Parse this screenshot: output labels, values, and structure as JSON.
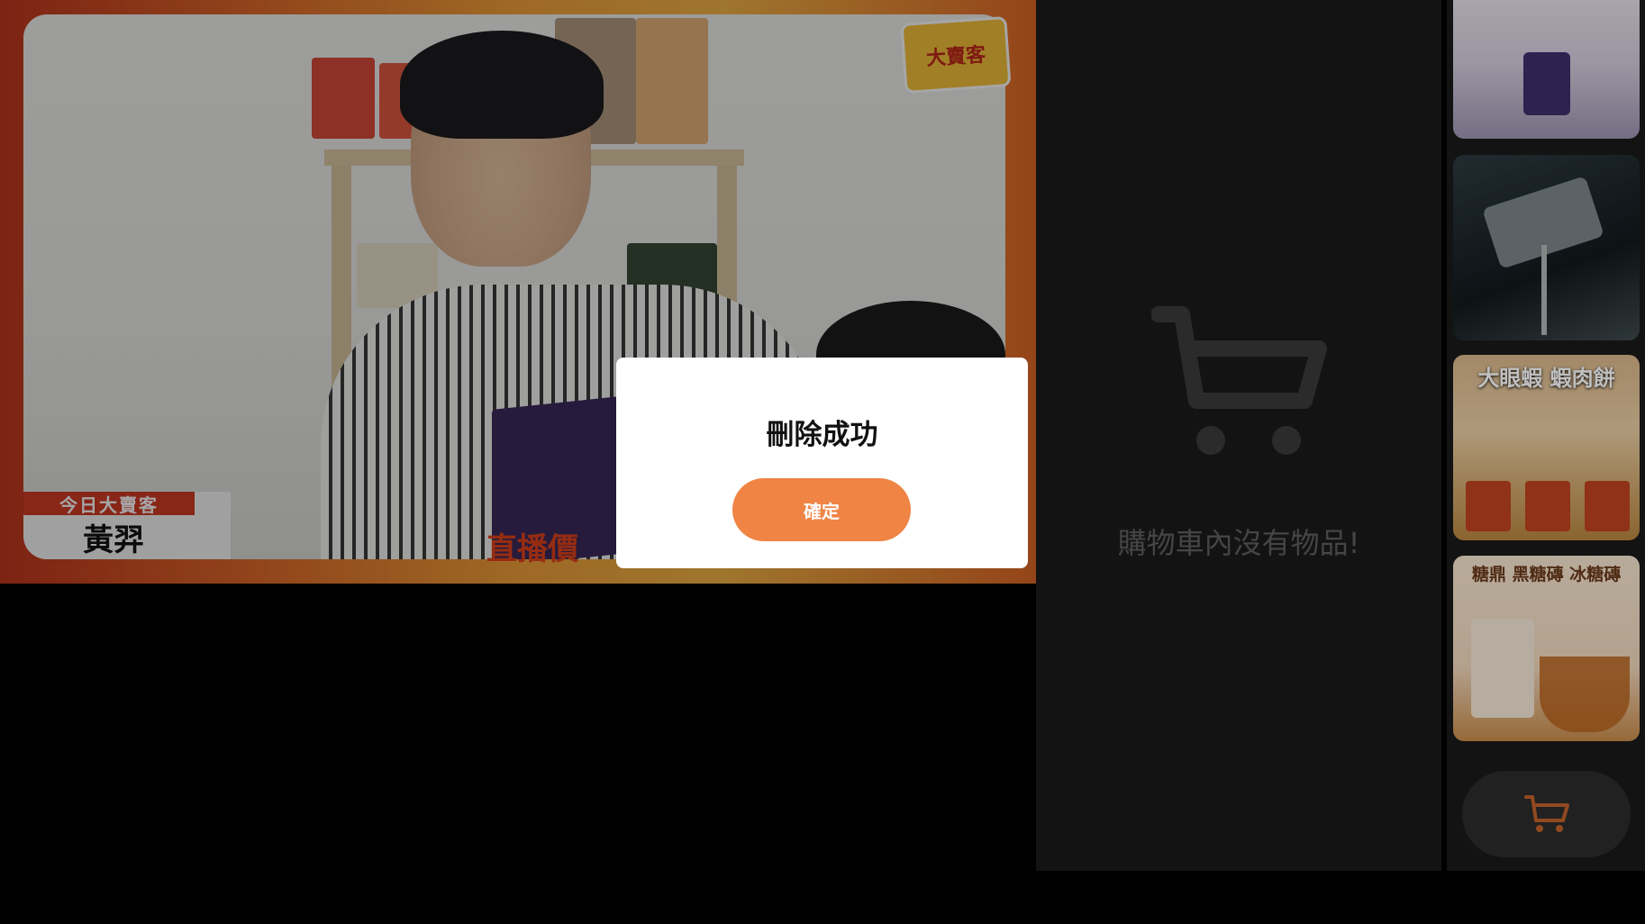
{
  "video": {
    "lower_third_tag": "今日大賣客",
    "host_name": "黃羿",
    "logo_text": "大賣客",
    "price_banner": "直播價"
  },
  "cart": {
    "empty_message": "購物車內沒有物品!"
  },
  "product_strip": {
    "items": [
      {
        "label": ""
      },
      {
        "label": ""
      },
      {
        "label": "大眼蝦 蝦肉餅"
      },
      {
        "label": "糖鼎 黑糖磚 冰糖磚"
      }
    ]
  },
  "dialog": {
    "title": "刪除成功",
    "confirm_label": "確定"
  },
  "colors": {
    "accent": "#ef8444",
    "panel_bg": "#1a1a1a"
  }
}
